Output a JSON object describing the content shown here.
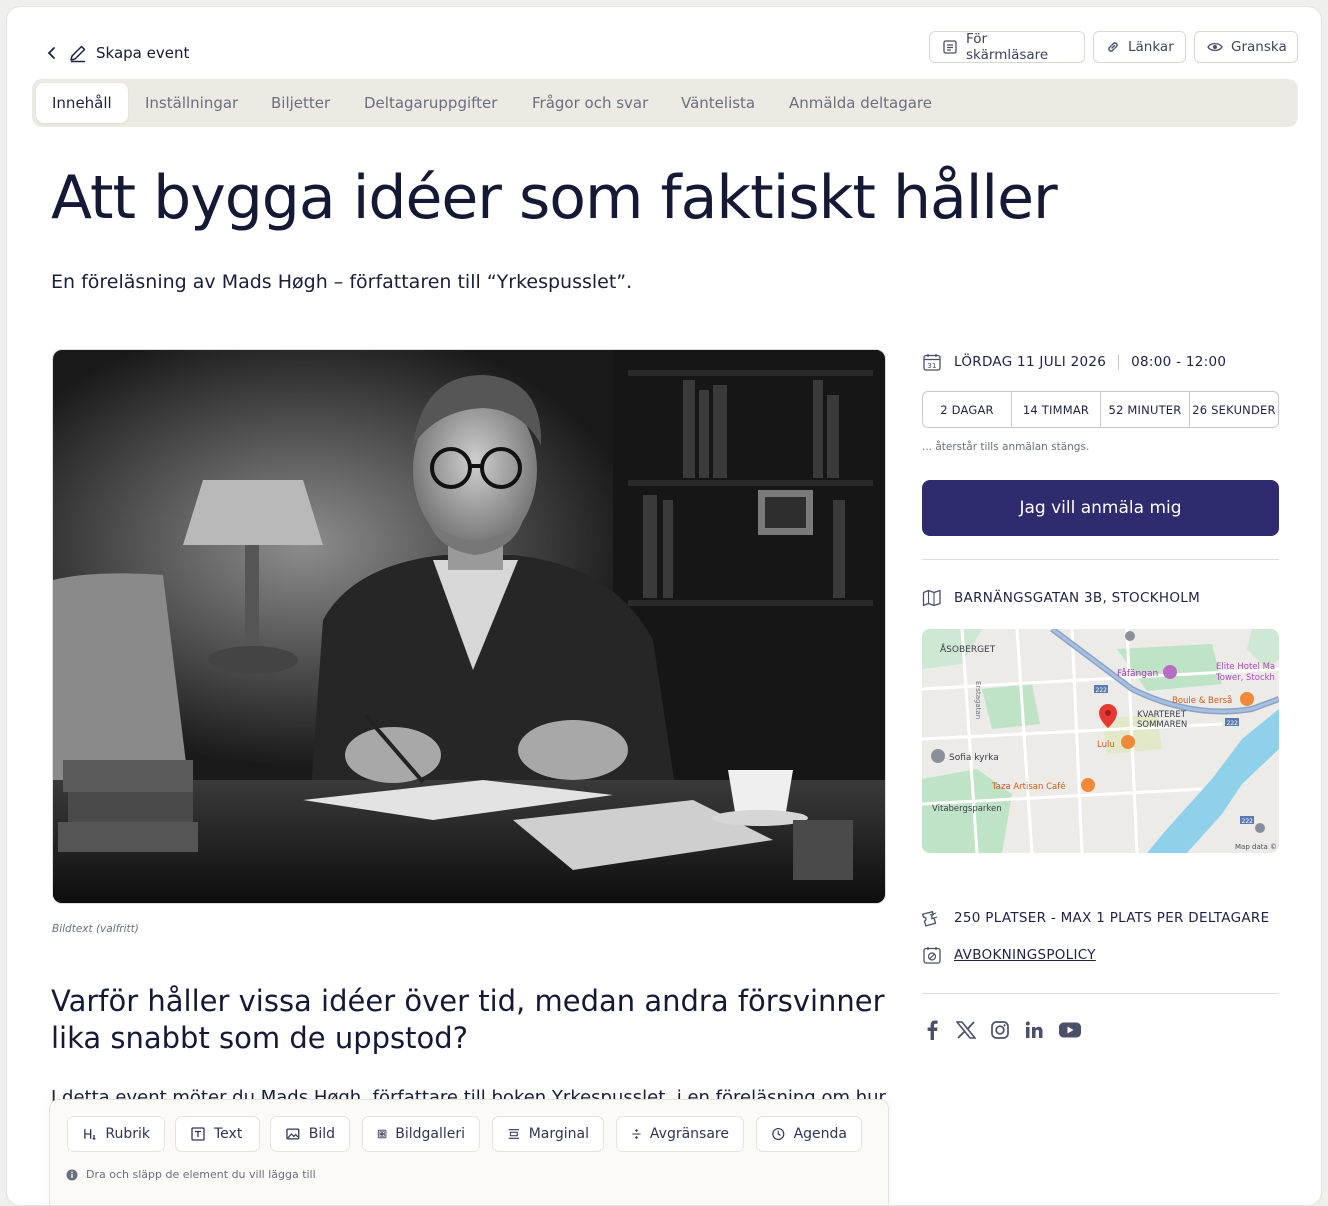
{
  "header": {
    "title": "Skapa event",
    "buttons": {
      "screen_reader": "För skärmläsare",
      "links": "Länkar",
      "review": "Granska"
    }
  },
  "tabs": [
    "Innehåll",
    "Inställningar",
    "Biljetter",
    "Deltagaruppgifter",
    "Frågor och svar",
    "Väntelista",
    "Anmälda deltagare"
  ],
  "active_tab": "Innehåll",
  "event": {
    "title": "Att bygga idéer som faktiskt håller",
    "subtitle": "En föreläsning av Mads Høgh – författaren till “Yrkespusslet”.",
    "image_caption": "Bildtext (valfritt)",
    "heading": "Varför håller vissa idéer över tid, medan andra försvinner lika snabbt som de uppstod?",
    "paragraph": "I detta event möter du Mads Høgh, författare till boken Yrkespusslet, i en föreläsning om hur"
  },
  "toolbar": {
    "items": [
      "Rubrik",
      "Text",
      "Bild",
      "Bildgalleri",
      "Marginal",
      "Avgränsare",
      "Agenda"
    ],
    "hint": "Dra och släpp de element du vill lägga till"
  },
  "sidebar": {
    "date": "LÖRDAG 11 JULI 2026",
    "time": "08:00 - 12:00",
    "calendar_day": "31",
    "countdown": [
      "2 DAGAR",
      "14 TIMMAR",
      "52 MINUTER",
      "26 SEKUNDER"
    ],
    "countdown_note": "... återstår tills anmälan stängs.",
    "register_button": "Jag vill anmäla mig",
    "address": "BARNÄNGSGATAN 3B, STOCKHOLM",
    "capacity": "250 PLATSER - MAX 1 PLATS PER DELTAGARE",
    "cancellation": "AVBOKNINGSPOLICY"
  },
  "map": {
    "labels": {
      "asoberget": "ÅSOBERGET",
      "erstagatan": "Erstagatan",
      "fafangan": "Fåfängan",
      "elite1": "Elite Hotel Ma",
      "elite2": "Tower, Stockh",
      "boule": "Boule & Berså",
      "kvarteret1": "KVARTERET",
      "kvarteret2": "SOMMAREN",
      "lulu": "Lulu",
      "sofia": "Sofia kyrka",
      "taza": "Taza Artisan Café",
      "vitabergsparken": "Vitabergsparken",
      "road_222": "222",
      "map_data": "Map data ©"
    }
  },
  "socials": [
    "facebook",
    "x",
    "instagram",
    "linkedin",
    "youtube"
  ],
  "colors": {
    "primary": "#2e2b6e",
    "text": "#141936",
    "tab_bar": "#edeae4",
    "map_green": "#bfe3c6",
    "map_water": "#8fd1ea"
  }
}
